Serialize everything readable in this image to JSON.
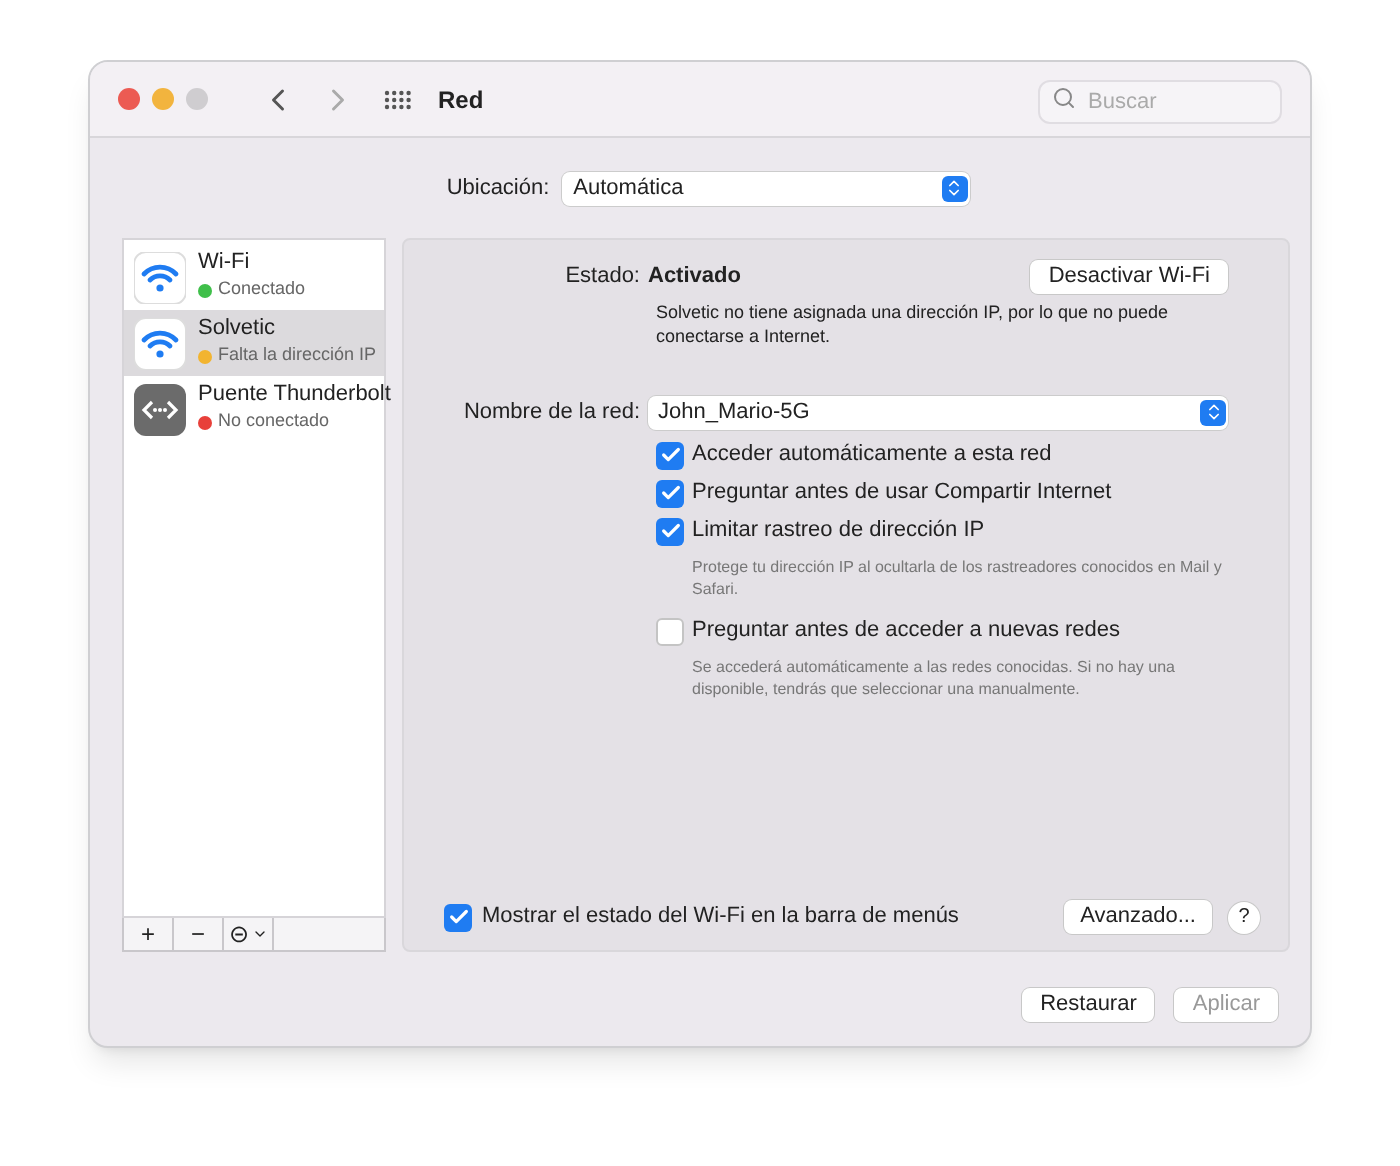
{
  "window": {
    "title": "Red",
    "search": {
      "placeholder": "Buscar"
    }
  },
  "location": {
    "label": "Ubicación:",
    "value": "Automática"
  },
  "services": [
    {
      "name": "Wi-Fi",
      "status": "Conectado",
      "color": "#3fbf4a",
      "kind": "wifi",
      "selected": false
    },
    {
      "name": "Solvetic",
      "status": "Falta la dirección IP",
      "color": "#f2b430",
      "kind": "wifi",
      "selected": true
    },
    {
      "name": "Puente Thunderbolt",
      "status": "No conectado",
      "color": "#e8403a",
      "kind": "thunderbolt",
      "selected": false
    }
  ],
  "service_toolbar": [
    "+",
    "−",
    "⊝"
  ],
  "detail": {
    "status_label": "Estado:",
    "status_value": "Activado",
    "toggle_button": "Desactivar Wi-Fi",
    "status_note": "Solvetic no tiene asignada una dirección IP, por lo que no puede conectarse a Internet.",
    "network_label": "Nombre de la red:",
    "network_value": "John_Mario-5G",
    "options": [
      {
        "label": "Acceder automáticamente a esta red",
        "checked": true
      },
      {
        "label": "Preguntar antes de usar Compartir Internet",
        "checked": true
      },
      {
        "label": "Limitar rastreo de dirección IP",
        "checked": true,
        "note": "Protege tu dirección IP al ocultarla de los rastreadores conocidos en Mail y Safari."
      },
      {
        "label": "Preguntar antes de acceder a nuevas redes",
        "checked": false,
        "note": "Se accederá automáticamente a las redes conocidas. Si no hay una disponible, tendrás que seleccionar una manualmente."
      }
    ],
    "menu_bar_option": {
      "label": "Mostrar el estado del Wi-Fi en la barra de menús",
      "checked": true
    },
    "advanced_button": "Avanzado...",
    "help_button": "?"
  },
  "footer_buttons": [
    {
      "label": "Restaurar",
      "disabled": false
    },
    {
      "label": "Aplicar",
      "disabled": true
    }
  ]
}
